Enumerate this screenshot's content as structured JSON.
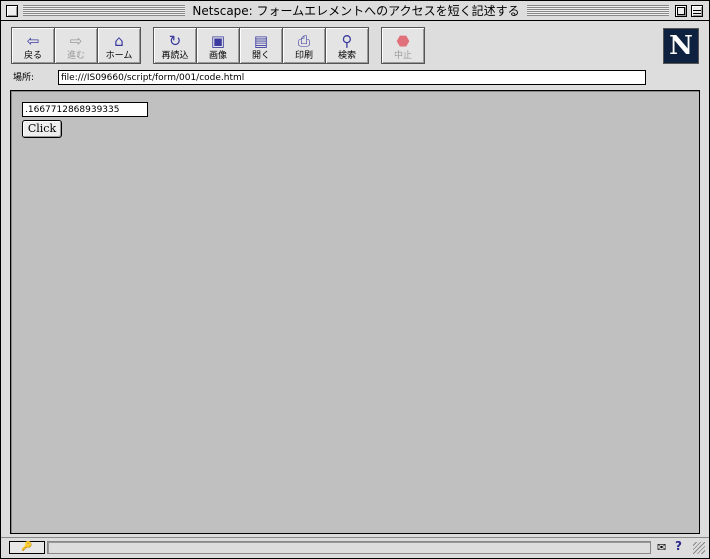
{
  "window": {
    "title": "Netscape: フォームエレメントへのアクセスを短く記述する"
  },
  "toolbar": {
    "buttons": [
      {
        "label": "戻る",
        "icon": "back-arrow-icon",
        "glyph": "⇦"
      },
      {
        "label": "進む",
        "icon": "forward-arrow-icon",
        "glyph": "⇨"
      },
      {
        "label": "ホーム",
        "icon": "home-icon",
        "glyph": "⌂"
      },
      {
        "label": "再読込",
        "icon": "reload-icon",
        "glyph": "↻"
      },
      {
        "label": "画像",
        "icon": "images-icon",
        "glyph": "▣"
      },
      {
        "label": "開く",
        "icon": "open-icon",
        "glyph": "▤"
      },
      {
        "label": "印刷",
        "icon": "print-icon",
        "glyph": "⎙"
      },
      {
        "label": "検索",
        "icon": "find-icon",
        "glyph": "⚲"
      },
      {
        "label": "中止",
        "icon": "stop-icon",
        "glyph": "⬣"
      }
    ],
    "logo_letter": "N"
  },
  "location": {
    "label": "場所:",
    "url": "file:///IS09660/script/form/001/code.html"
  },
  "content": {
    "input_value": ".1667712868939335",
    "button_label": "Click"
  },
  "statusbar": {
    "security_glyph": "🔑",
    "mail_glyph": "✉",
    "help_glyph": "?"
  },
  "colors": {
    "content_bg": "#c0c0c0",
    "chrome_bg": "#dddddd",
    "icon_blue": "#3a3aa0",
    "stop_pink": "#e0707a",
    "logo_bg": "#0e2240"
  }
}
